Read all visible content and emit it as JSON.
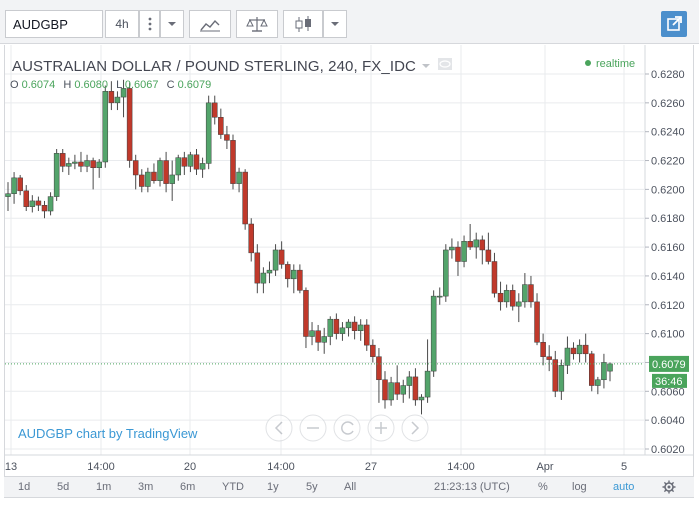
{
  "toolbar": {
    "symbol": "AUDGBP",
    "interval": "4h",
    "colors": {
      "external_button": "#4c8fcc"
    }
  },
  "legend": {
    "title": "AUSTRALIAN DOLLAR / POUND STERLING, 240, FX_IDC",
    "o_label": "O",
    "o": "0.6074",
    "h_label": "H",
    "h": "0.6080",
    "l_label": "L",
    "l": "0.6067",
    "c_label": "C",
    "c": "0.6079",
    "realtime": "realtime"
  },
  "watermark": "AUDGBP chart by TradingView",
  "bottom": {
    "ranges": [
      "1d",
      "5d",
      "1m",
      "3m",
      "6m",
      "YTD",
      "1y",
      "5y",
      "All"
    ],
    "time": "21:23:13 (UTC)",
    "percent": "%",
    "log": "log",
    "auto": "auto"
  },
  "chart_data": {
    "type": "candlestick",
    "y_ticks": [
      "0.6280",
      "0.6260",
      "0.6240",
      "0.6220",
      "0.6200",
      "0.6180",
      "0.6160",
      "0.6140",
      "0.6120",
      "0.6100",
      "0.6080",
      "0.6060",
      "0.6040",
      "0.6020"
    ],
    "x_ticks": [
      "13",
      "14:00",
      "20",
      "14:00",
      "27",
      "14:00",
      "Apr",
      "5"
    ],
    "last_price": "0.6079",
    "countdown": "36:46",
    "colors": {
      "up": "#53a46b",
      "down": "#c0392b",
      "price_line": "#4aa45c",
      "grid": "#e9ebee"
    },
    "candles": [
      [
        0.6195,
        0.6205,
        0.6185,
        0.6197
      ],
      [
        0.6197,
        0.6212,
        0.619,
        0.6208
      ],
      [
        0.6208,
        0.621,
        0.6196,
        0.6199
      ],
      [
        0.6199,
        0.6203,
        0.6185,
        0.6188
      ],
      [
        0.6188,
        0.6196,
        0.6184,
        0.6192
      ],
      [
        0.6192,
        0.6195,
        0.6185,
        0.6189
      ],
      [
        0.6189,
        0.6192,
        0.618,
        0.6185
      ],
      [
        0.6185,
        0.6198,
        0.6182,
        0.6195
      ],
      [
        0.6195,
        0.6228,
        0.6192,
        0.6225
      ],
      [
        0.6225,
        0.6228,
        0.6212,
        0.6216
      ],
      [
        0.6216,
        0.6222,
        0.621,
        0.6218
      ],
      [
        0.6218,
        0.6224,
        0.6214,
        0.6219
      ],
      [
        0.6219,
        0.6226,
        0.6212,
        0.6216
      ],
      [
        0.6216,
        0.6224,
        0.6212,
        0.622
      ],
      [
        0.622,
        0.6222,
        0.62,
        0.6215
      ],
      [
        0.6215,
        0.6221,
        0.6208,
        0.6219
      ],
      [
        0.6219,
        0.6272,
        0.6215,
        0.6268
      ],
      [
        0.6268,
        0.6275,
        0.6255,
        0.626
      ],
      [
        0.626,
        0.6268,
        0.6255,
        0.6264
      ],
      [
        0.6264,
        0.6276,
        0.625,
        0.627
      ],
      [
        0.627,
        0.6274,
        0.6215,
        0.622
      ],
      [
        0.622,
        0.6224,
        0.62,
        0.621
      ],
      [
        0.621,
        0.6214,
        0.6198,
        0.6202
      ],
      [
        0.6202,
        0.6215,
        0.6198,
        0.6212
      ],
      [
        0.6212,
        0.6218,
        0.6204,
        0.6206
      ],
      [
        0.6206,
        0.6222,
        0.6202,
        0.622
      ],
      [
        0.622,
        0.6226,
        0.6198,
        0.6204
      ],
      [
        0.6204,
        0.622,
        0.6192,
        0.621
      ],
      [
        0.621,
        0.6224,
        0.6206,
        0.6222
      ],
      [
        0.6222,
        0.6226,
        0.621,
        0.6216
      ],
      [
        0.6216,
        0.6226,
        0.6212,
        0.6224
      ],
      [
        0.6224,
        0.6228,
        0.621,
        0.6214
      ],
      [
        0.6214,
        0.6222,
        0.6208,
        0.6218
      ],
      [
        0.6218,
        0.6265,
        0.6214,
        0.626
      ],
      [
        0.626,
        0.6265,
        0.6245,
        0.625
      ],
      [
        0.625,
        0.6256,
        0.6235,
        0.6238
      ],
      [
        0.6238,
        0.6244,
        0.6228,
        0.6234
      ],
      [
        0.6234,
        0.6238,
        0.62,
        0.6204
      ],
      [
        0.6204,
        0.6215,
        0.6198,
        0.6212
      ],
      [
        0.6212,
        0.6214,
        0.6172,
        0.6176
      ],
      [
        0.6176,
        0.618,
        0.615,
        0.6156
      ],
      [
        0.6156,
        0.6162,
        0.6128,
        0.6135
      ],
      [
        0.6135,
        0.6146,
        0.6128,
        0.6142
      ],
      [
        0.6142,
        0.615,
        0.6135,
        0.6144
      ],
      [
        0.6144,
        0.6162,
        0.614,
        0.6158
      ],
      [
        0.6158,
        0.6164,
        0.6145,
        0.6148
      ],
      [
        0.6148,
        0.615,
        0.6132,
        0.6138
      ],
      [
        0.6138,
        0.6148,
        0.6128,
        0.6144
      ],
      [
        0.6144,
        0.6148,
        0.6128,
        0.613
      ],
      [
        0.613,
        0.6132,
        0.609,
        0.6098
      ],
      [
        0.6098,
        0.6108,
        0.6092,
        0.6102
      ],
      [
        0.6102,
        0.6106,
        0.6088,
        0.6094
      ],
      [
        0.6094,
        0.6104,
        0.6086,
        0.6098
      ],
      [
        0.6098,
        0.6112,
        0.6092,
        0.611
      ],
      [
        0.611,
        0.6114,
        0.6096,
        0.61
      ],
      [
        0.61,
        0.6108,
        0.6095,
        0.6104
      ],
      [
        0.6104,
        0.611,
        0.6098,
        0.6108
      ],
      [
        0.6108,
        0.6112,
        0.6096,
        0.6102
      ],
      [
        0.6102,
        0.611,
        0.6095,
        0.6106
      ],
      [
        0.6106,
        0.611,
        0.6088,
        0.6092
      ],
      [
        0.6092,
        0.6096,
        0.608,
        0.6084
      ],
      [
        0.6084,
        0.609,
        0.6052,
        0.6068
      ],
      [
        0.6068,
        0.6074,
        0.6048,
        0.6054
      ],
      [
        0.6054,
        0.607,
        0.605,
        0.6066
      ],
      [
        0.6066,
        0.6078,
        0.6054,
        0.6058
      ],
      [
        0.6058,
        0.6068,
        0.6052,
        0.6064
      ],
      [
        0.6064,
        0.6074,
        0.6055,
        0.607
      ],
      [
        0.607,
        0.6076,
        0.605,
        0.6054
      ],
      [
        0.6054,
        0.6058,
        0.6044,
        0.6056
      ],
      [
        0.6056,
        0.6096,
        0.6052,
        0.6074
      ],
      [
        0.6074,
        0.613,
        0.607,
        0.6126
      ],
      [
        0.6126,
        0.6132,
        0.612,
        0.6126
      ],
      [
        0.6126,
        0.6162,
        0.6122,
        0.6158
      ],
      [
        0.6158,
        0.6166,
        0.6152,
        0.616
      ],
      [
        0.616,
        0.6164,
        0.614,
        0.615
      ],
      [
        0.615,
        0.6168,
        0.6146,
        0.6164
      ],
      [
        0.6164,
        0.6176,
        0.6158,
        0.616
      ],
      [
        0.616,
        0.617,
        0.6152,
        0.6165
      ],
      [
        0.6165,
        0.6168,
        0.6148,
        0.6158
      ],
      [
        0.6158,
        0.617,
        0.6148,
        0.615
      ],
      [
        0.615,
        0.6156,
        0.6125,
        0.6128
      ],
      [
        0.6128,
        0.6136,
        0.6116,
        0.6122
      ],
      [
        0.6122,
        0.6134,
        0.6118,
        0.613
      ],
      [
        0.613,
        0.6134,
        0.6116,
        0.6119
      ],
      [
        0.6119,
        0.6128,
        0.6108,
        0.6122
      ],
      [
        0.6122,
        0.6142,
        0.6118,
        0.6134
      ],
      [
        0.6134,
        0.614,
        0.6118,
        0.6122
      ],
      [
        0.6122,
        0.6128,
        0.6092,
        0.6094
      ],
      [
        0.6094,
        0.61,
        0.6078,
        0.6084
      ],
      [
        0.6084,
        0.6092,
        0.6074,
        0.6082
      ],
      [
        0.6082,
        0.6088,
        0.6056,
        0.606
      ],
      [
        0.606,
        0.6082,
        0.6054,
        0.6078
      ],
      [
        0.6078,
        0.6098,
        0.6072,
        0.609
      ],
      [
        0.609,
        0.6094,
        0.6082,
        0.6086
      ],
      [
        0.6086,
        0.6096,
        0.608,
        0.6092
      ],
      [
        0.6092,
        0.61,
        0.608,
        0.6086
      ],
      [
        0.6086,
        0.6088,
        0.606,
        0.6064
      ],
      [
        0.6064,
        0.607,
        0.6058,
        0.6068
      ],
      [
        0.6068,
        0.6086,
        0.6062,
        0.608
      ],
      [
        0.6074,
        0.608,
        0.6067,
        0.6079
      ]
    ]
  }
}
